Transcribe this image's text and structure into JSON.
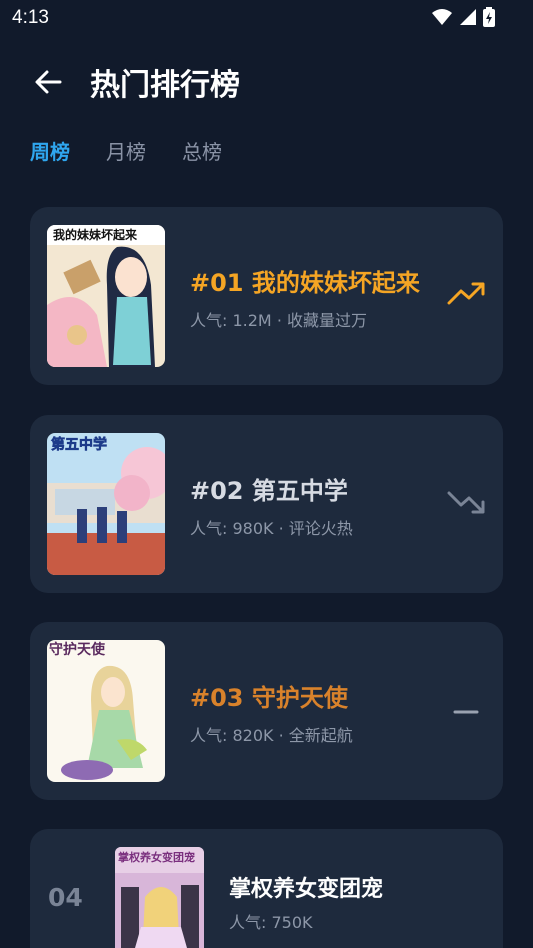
{
  "status_bar": {
    "time": "4:13"
  },
  "header": {
    "title": "热门排行榜"
  },
  "tabs": [
    {
      "label": "周榜",
      "active": true
    },
    {
      "label": "月榜",
      "active": false
    },
    {
      "label": "总榜",
      "active": false
    }
  ],
  "items": [
    {
      "rank_title": "#01 我的妹妹坏起来",
      "subtitle": "人气: 1.2M · 收藏量过万",
      "title_color": "#f5a524",
      "trend": "trending-up",
      "trend_color": "#f5a524",
      "cover_text": "我的妹妹坏起来"
    },
    {
      "rank_title": "#02 第五中学",
      "subtitle": "人气: 980K · 评论火热",
      "title_color": "#d7dbe3",
      "trend": "trending-down",
      "trend_color": "#7a8496",
      "cover_text": "第五中学"
    },
    {
      "rank_title": "#03 守护天使",
      "subtitle": "人气: 820K · 全新起航",
      "title_color": "#d9822b",
      "trend": "steady",
      "trend_color": "#9aa2b1",
      "cover_text": "守护天使"
    },
    {
      "rank": "04",
      "rank_title": "掌权养女变团宠",
      "subtitle": "人气: 750K",
      "title_color": "#ffffff",
      "cover_text": "掌权养女变团宠"
    }
  ]
}
